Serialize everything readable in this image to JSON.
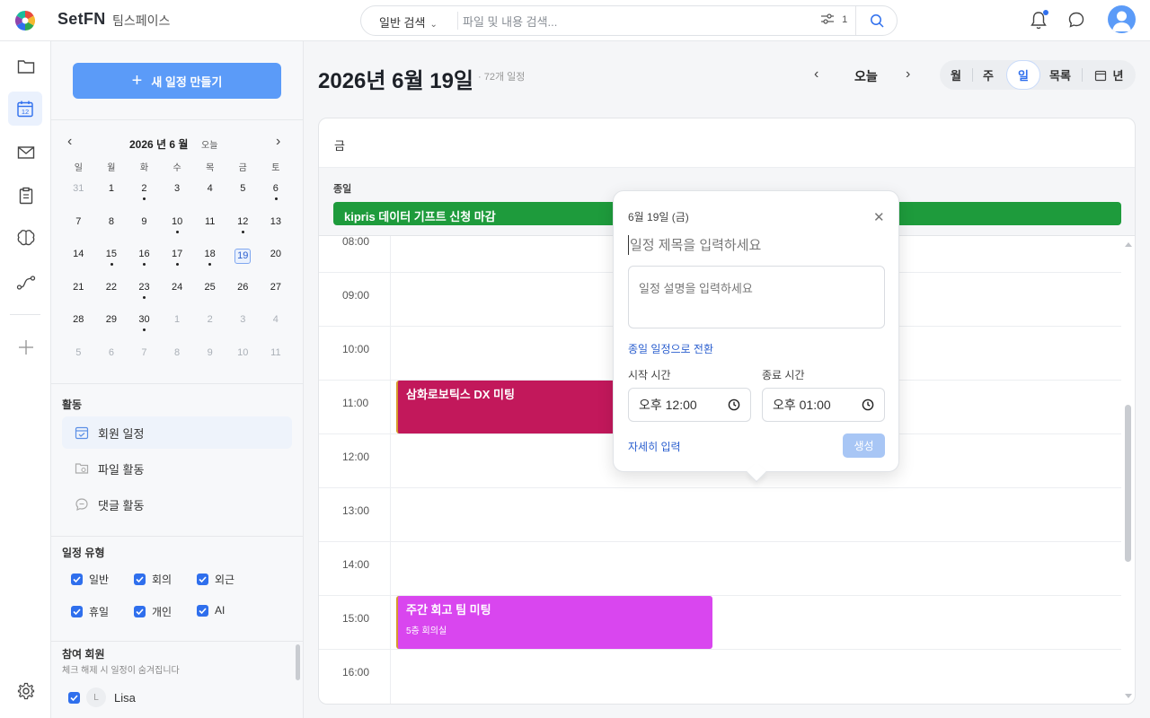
{
  "app": {
    "brand": "SetFN",
    "workspace": "팀스페이스"
  },
  "search": {
    "mode": "일반 검색",
    "placeholder": "파일 및 내용 검색...",
    "filter_count": "1"
  },
  "sidebar": {
    "new_button": "새 일정 만들기",
    "mini_cal": {
      "title": "2026 년 6 월",
      "today_label": "오늘",
      "dow": [
        "일",
        "월",
        "화",
        "수",
        "목",
        "금",
        "토"
      ],
      "weeks": [
        [
          {
            "d": "31",
            "o": true
          },
          {
            "d": "1"
          },
          {
            "d": "2",
            "dot": true
          },
          {
            "d": "3"
          },
          {
            "d": "4"
          },
          {
            "d": "5"
          },
          {
            "d": "6",
            "dot": true
          }
        ],
        [
          {
            "d": "7"
          },
          {
            "d": "8"
          },
          {
            "d": "9"
          },
          {
            "d": "10",
            "dot": true
          },
          {
            "d": "11"
          },
          {
            "d": "12",
            "dot": true
          },
          {
            "d": "13"
          }
        ],
        [
          {
            "d": "14"
          },
          {
            "d": "15",
            "dot": true
          },
          {
            "d": "16",
            "dot": true
          },
          {
            "d": "17",
            "dot": true
          },
          {
            "d": "18",
            "dot": true
          },
          {
            "d": "19",
            "today": true
          },
          {
            "d": "20"
          }
        ],
        [
          {
            "d": "21"
          },
          {
            "d": "22"
          },
          {
            "d": "23",
            "dot": true
          },
          {
            "d": "24"
          },
          {
            "d": "25"
          },
          {
            "d": "26"
          },
          {
            "d": "27"
          }
        ],
        [
          {
            "d": "28"
          },
          {
            "d": "29"
          },
          {
            "d": "30",
            "dot": true
          },
          {
            "d": "1",
            "o": true
          },
          {
            "d": "2",
            "o": true
          },
          {
            "d": "3",
            "o": true
          },
          {
            "d": "4",
            "o": true
          }
        ],
        [
          {
            "d": "5",
            "o": true
          },
          {
            "d": "6",
            "o": true
          },
          {
            "d": "7",
            "o": true
          },
          {
            "d": "8",
            "o": true
          },
          {
            "d": "9",
            "o": true
          },
          {
            "d": "10",
            "o": true
          },
          {
            "d": "11",
            "o": true
          }
        ]
      ]
    },
    "activity": {
      "heading": "활동",
      "items": [
        "회원 일정",
        "파일 활동",
        "댓글 활동"
      ]
    },
    "types": {
      "heading": "일정 유형",
      "items": [
        "일반",
        "회의",
        "외근",
        "휴일",
        "개인",
        "AI"
      ]
    },
    "members": {
      "heading": "참여 회원",
      "subtitle": "체크 해제 시 일정이 숨겨집니다",
      "list": [
        {
          "initial": "L",
          "name": "Lisa"
        }
      ]
    }
  },
  "main": {
    "title": "2026년 6월 19일",
    "count": "72개 일정",
    "today_button": "오늘",
    "views": {
      "month": "월",
      "week": "주",
      "day": "일",
      "list": "목록",
      "year": "년"
    },
    "day_of_week": "금",
    "allday_label": "종일",
    "allday_event": {
      "title": "kipris 데이터 기프트 신청 마감",
      "color": "#1e9b3c"
    },
    "hours": [
      "08:00",
      "09:00",
      "10:00",
      "11:00",
      "12:00",
      "13:00",
      "14:00",
      "15:00",
      "16:00"
    ],
    "events": [
      {
        "title": "삼화로보틱스 DX 미팅",
        "sub": "",
        "start": 11,
        "end": 12,
        "color": "#c2185b"
      },
      {
        "title": "주간 회고 팀 미팅",
        "sub": "5층 회의실",
        "start": 15,
        "end": 16,
        "color": "#d946ef"
      }
    ]
  },
  "popover": {
    "date": "6월 19일 (금)",
    "title_placeholder": "일정 제목을 입력하세요",
    "desc_placeholder": "일정 설명을 입력하세요",
    "allday_toggle": "종일 일정으로 전환",
    "start_label": "시작 시간",
    "end_label": "종료 시간",
    "start_time": "오후 12:00",
    "end_time": "오후 01:00",
    "detail_link": "자세히 입력",
    "create_button": "생성"
  },
  "colors": {
    "accent": "#5b9bf8",
    "link": "#2b5fcf"
  }
}
